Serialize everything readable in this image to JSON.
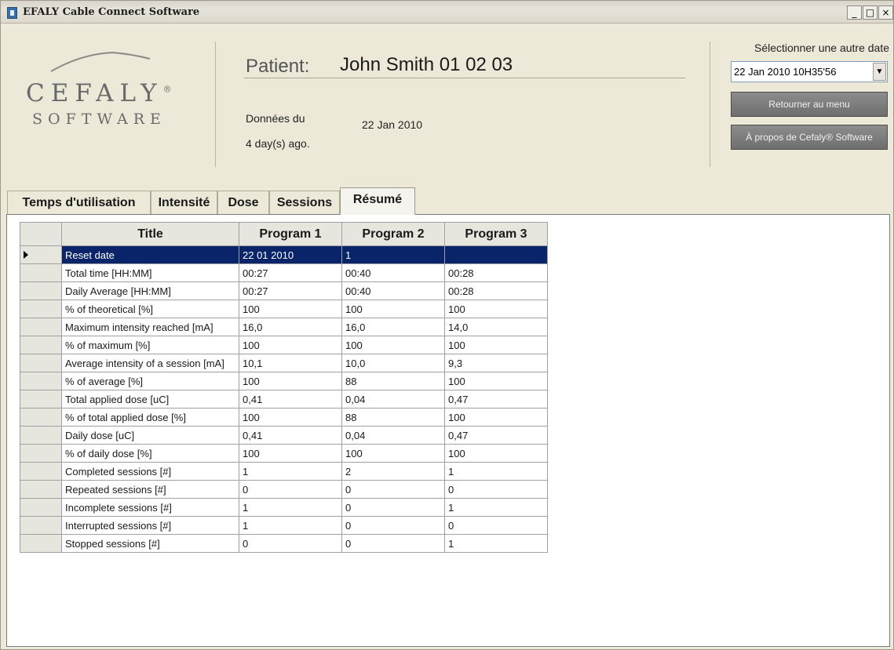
{
  "window": {
    "title": "EFALY Cable Connect Software",
    "buttons": [
      "_",
      "□",
      "×"
    ]
  },
  "logo": {
    "title": "CEFALY",
    "registered": "®",
    "subtitle": "SOFTWARE"
  },
  "patient": {
    "label": "Patient:",
    "name": "John Smith 01 02 03"
  },
  "data_info": {
    "label": "Données du",
    "date": "22 Jan 2010",
    "ago": "4 day(s) ago."
  },
  "date_select": {
    "label": "Sélectionner une autre date",
    "value": "22 Jan 2010 10H35'56"
  },
  "buttons": {
    "menu": "Retourner au menu",
    "about": "À propos de Cefaly® Software"
  },
  "tabs": [
    {
      "label": "Temps d'utilisation",
      "active": false
    },
    {
      "label": "Intensité",
      "active": false
    },
    {
      "label": "Dose",
      "active": false
    },
    {
      "label": "Sessions",
      "active": false
    },
    {
      "label": "Résumé",
      "active": true
    }
  ],
  "table": {
    "headers": [
      "Title",
      "Program 1",
      "Program 2",
      "Program 3"
    ],
    "rows": [
      [
        "Reset date",
        "22 01 2010",
        "1",
        ""
      ],
      [
        "Total time [HH:MM]",
        "00:27",
        "00:40",
        "00:28"
      ],
      [
        "Daily Average [HH:MM]",
        "00:27",
        "00:40",
        "00:28"
      ],
      [
        "% of theoretical [%]",
        "100",
        "100",
        "100"
      ],
      [
        "Maximum intensity reached [mA]",
        "16,0",
        "16,0",
        "14,0"
      ],
      [
        "% of maximum [%]",
        "100",
        "100",
        "100"
      ],
      [
        "Average intensity of a session [mA]",
        "10,1",
        "10,0",
        "9,3"
      ],
      [
        "% of average [%]",
        "100",
        "88",
        "100"
      ],
      [
        "Total applied dose [uC]",
        "0,41",
        "0,04",
        "0,47"
      ],
      [
        "% of total applied dose [%]",
        "100",
        "88",
        "100"
      ],
      [
        "Daily dose [uC]",
        "0,41",
        "0,04",
        "0,47"
      ],
      [
        "% of daily dose [%]",
        "100",
        "100",
        "100"
      ],
      [
        "Completed sessions [#]",
        "1",
        "2",
        "1"
      ],
      [
        "Repeated sessions [#]",
        "0",
        "0",
        "0"
      ],
      [
        "Incomplete sessions [#]",
        "1",
        "0",
        "1"
      ],
      [
        "Interrupted sessions [#]",
        "1",
        "0",
        "0"
      ],
      [
        "Stopped sessions [#]",
        "0",
        "0",
        "1"
      ]
    ],
    "selected_row": 0
  }
}
